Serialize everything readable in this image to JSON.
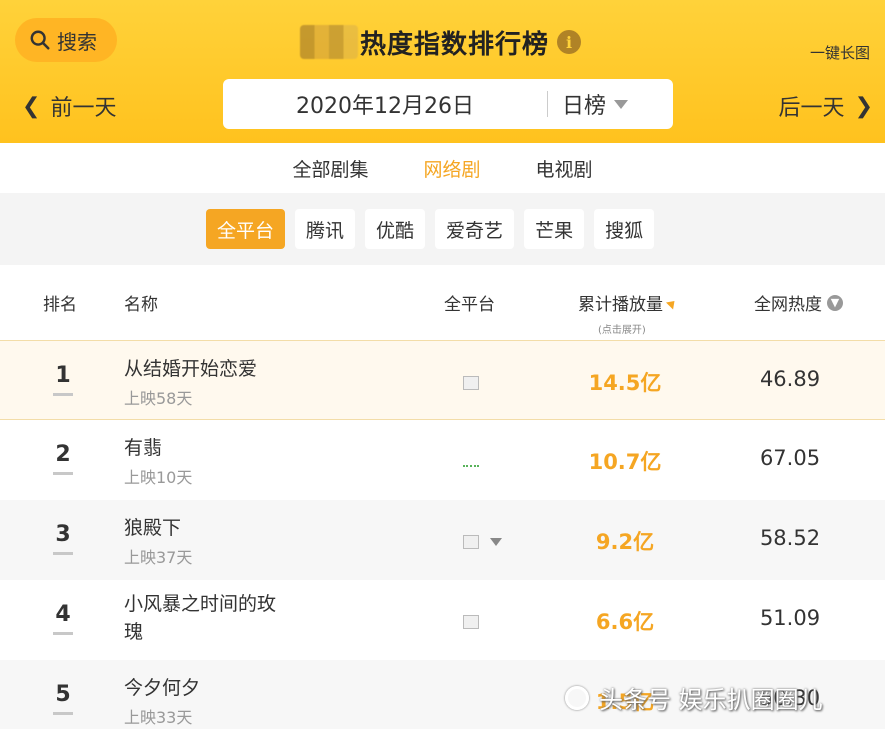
{
  "header": {
    "search_label": "搜索",
    "title": "热度指数排行榜",
    "info_glyph": "i",
    "longshot_label": "一键长图",
    "prev_label": "前一天",
    "next_label": "后一天",
    "date": "2020年12月26日",
    "period": "日榜"
  },
  "category_tabs": [
    {
      "label": "全部剧集",
      "active": false
    },
    {
      "label": "网络剧",
      "active": true
    },
    {
      "label": "电视剧",
      "active": false
    }
  ],
  "platforms": [
    {
      "label": "全平台",
      "active": true
    },
    {
      "label": "腾讯",
      "active": false
    },
    {
      "label": "优酷",
      "active": false
    },
    {
      "label": "爱奇艺",
      "active": false
    },
    {
      "label": "芒果",
      "active": false
    },
    {
      "label": "搜狐",
      "active": false
    }
  ],
  "table": {
    "columns": {
      "rank": "排名",
      "name": "名称",
      "platform": "全平台",
      "play": "累计播放量",
      "play_sub": "(点击展开)",
      "heat": "全网热度"
    },
    "rows": [
      {
        "rank": "1",
        "name": "从结婚开始恋爱",
        "sub": "上映58天",
        "play": "14.5亿",
        "heat": "46.89"
      },
      {
        "rank": "2",
        "name": "有翡",
        "sub": "上映10天",
        "play": "10.7亿",
        "heat": "67.05"
      },
      {
        "rank": "3",
        "name": "狼殿下",
        "sub": "上映37天",
        "play": "9.2亿",
        "heat": "58.52"
      },
      {
        "rank": "4",
        "name": "小风暴之时间的玫瑰",
        "sub": "",
        "play": "6.6亿",
        "heat": "51.09"
      },
      {
        "rank": "5",
        "name": "今夕何夕",
        "sub": "上映33天",
        "play": "1.5亿",
        "heat": "50.30"
      }
    ]
  },
  "watermark": "头条号 娱乐扒圈圈儿",
  "colors": {
    "accent": "#f5a623",
    "header_bg": "#ffc92b"
  }
}
